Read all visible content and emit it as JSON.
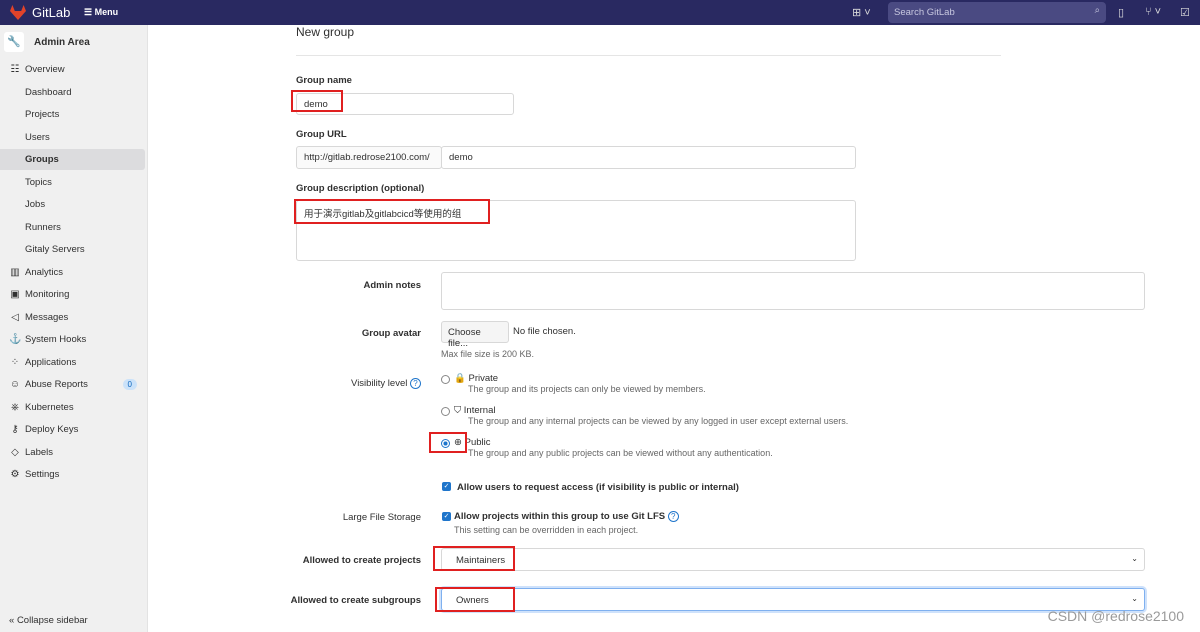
{
  "header": {
    "brand": "GitLab",
    "menu": "Menu",
    "search_placeholder": "Search GitLab"
  },
  "sidebar": {
    "title": "Admin Area",
    "items": [
      {
        "label": "Overview",
        "icon": "overview-icon",
        "section": true
      },
      {
        "label": "Dashboard"
      },
      {
        "label": "Projects"
      },
      {
        "label": "Users"
      },
      {
        "label": "Groups",
        "active": true
      },
      {
        "label": "Topics"
      },
      {
        "label": "Jobs"
      },
      {
        "label": "Runners"
      },
      {
        "label": "Gitaly Servers"
      },
      {
        "label": "Analytics",
        "icon": "analytics-icon",
        "section": true
      },
      {
        "label": "Monitoring",
        "icon": "monitor-icon",
        "section": true
      },
      {
        "label": "Messages",
        "icon": "megaphone-icon",
        "section": true
      },
      {
        "label": "System Hooks",
        "icon": "anchor-icon",
        "section": true
      },
      {
        "label": "Applications",
        "icon": "applications-icon",
        "section": true
      },
      {
        "label": "Abuse Reports",
        "icon": "abuse-icon",
        "section": true,
        "badge": "0"
      },
      {
        "label": "Kubernetes",
        "icon": "kubernetes-icon",
        "section": true
      },
      {
        "label": "Deploy Keys",
        "icon": "key-icon",
        "section": true
      },
      {
        "label": "Labels",
        "icon": "label-icon",
        "section": true
      },
      {
        "label": "Settings",
        "icon": "settings-icon",
        "section": true
      }
    ],
    "collapse": "Collapse sidebar"
  },
  "form": {
    "title": "New group",
    "group_name_label": "Group name",
    "group_name": "demo",
    "group_url_label": "Group URL",
    "url_prefix": "http://gitlab.redrose2100.com/",
    "url_path": "demo",
    "desc_label": "Group description (optional)",
    "description": "用于演示gitlab及gitlabcicd等使用的组",
    "admin_notes_label": "Admin notes",
    "avatar_label": "Group avatar",
    "choose_file": "Choose file...",
    "no_file": "No file chosen.",
    "max_size": "Max file size is 200 KB.",
    "visibility_label": "Visibility level",
    "visibility": [
      {
        "label": "Private",
        "desc": "The group and its projects can only be viewed by members.",
        "icon": "lock-icon",
        "selected": false
      },
      {
        "label": "Internal",
        "desc": "The group and any internal projects can be viewed by any logged in user except external users.",
        "icon": "shield-icon",
        "selected": false
      },
      {
        "label": "Public",
        "desc": "The group and any public projects can be viewed without any authentication.",
        "icon": "globe-icon",
        "selected": true
      }
    ],
    "request_access": "Allow users to request access (if visibility is public or internal)",
    "lfs_label": "Large File Storage",
    "lfs_option": "Allow projects within this group to use Git LFS",
    "lfs_help": "This setting can be overridden in each project.",
    "create_projects_label": "Allowed to create projects",
    "create_projects": "Maintainers",
    "create_subgroups_label": "Allowed to create subgroups",
    "create_subgroups": "Owners"
  },
  "watermark": "CSDN @redrose2100"
}
